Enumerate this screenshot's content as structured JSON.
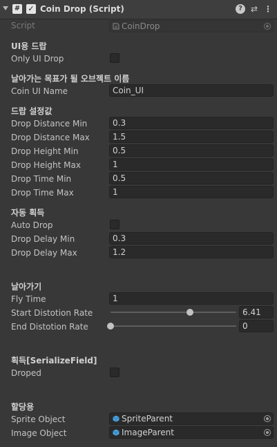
{
  "header": {
    "script_glyph": "#",
    "enabled_glyph": "✓",
    "title": "Coin Drop (Script)",
    "help_glyph": "?",
    "preset_glyph": "⇄",
    "menu_glyph": "⋮"
  },
  "script_row": {
    "label": "Script",
    "value": "CoinDrop"
  },
  "sections": {
    "ui_drop": "UI용 드랍",
    "target_name": "날아가는 목표가 될 오브젝트 이름",
    "drop_settings": "드랍 설정값",
    "auto_collect": "자동 획득",
    "fly": "날아가기",
    "collect": "획득[SerializeField]",
    "assign": "할당용"
  },
  "only_ui_drop": {
    "label": "Only UI Drop",
    "checked": false
  },
  "coin_ui_name": {
    "label": "Coin UI Name",
    "value": "Coin_UI"
  },
  "drop_fields": [
    {
      "label": "Drop Distance Min",
      "value": "0.3"
    },
    {
      "label": "Drop Distance Max",
      "value": "1.5"
    },
    {
      "label": "Drop Height Min",
      "value": "0.5"
    },
    {
      "label": "Drop Height Max",
      "value": "1"
    },
    {
      "label": "Drop Time Min",
      "value": "0.5"
    },
    {
      "label": "Drop Time Max",
      "value": "1"
    }
  ],
  "auto_drop": {
    "label": "Auto Drop",
    "checked": false
  },
  "delay_fields": [
    {
      "label": "Drop Delay Min",
      "value": "0.3"
    },
    {
      "label": "Drop Delay Max",
      "value": "1.2"
    }
  ],
  "fly_time": {
    "label": "Fly Time",
    "value": "1"
  },
  "start_distortion": {
    "label": "Start Distotion Rate",
    "value": "6.41",
    "fraction": 0.63
  },
  "end_distortion": {
    "label": "End Distotion Rate",
    "value": "0",
    "fraction": 0.0
  },
  "droped": {
    "label": "Droped",
    "checked": false
  },
  "sprite_object": {
    "label": "Sprite Object",
    "value": "SpriteParent",
    "icon": "cube-icon"
  },
  "image_object": {
    "label": "Image Object",
    "value": "ImageParent",
    "icon": "cube-icon"
  },
  "colors": {
    "background": "#383838",
    "header": "#3e3e3e",
    "field": "#2a2a2a",
    "cube_icon": "#4aa3df"
  }
}
